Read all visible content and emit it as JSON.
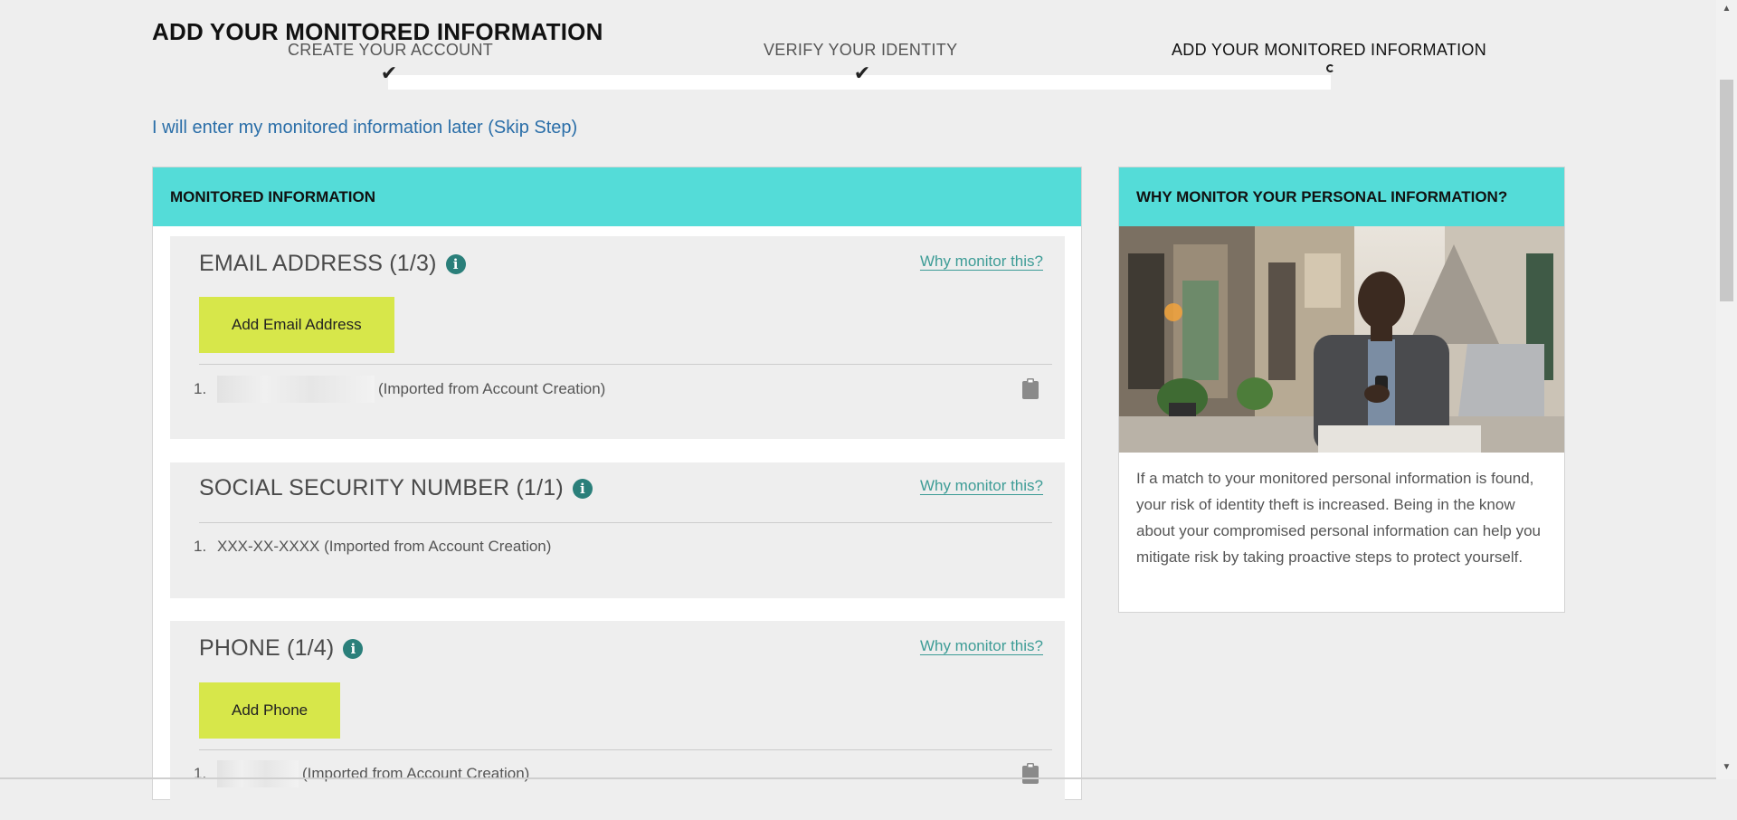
{
  "page": {
    "title": "ADD YOUR MONITORED INFORMATION"
  },
  "stepper": {
    "steps": [
      {
        "label": "CREATE YOUR ACCOUNT",
        "status": "complete"
      },
      {
        "label": "VERIFY YOUR IDENTITY",
        "status": "complete"
      },
      {
        "label": "ADD YOUR MONITORED INFORMATION",
        "status": "current"
      }
    ]
  },
  "skip_link": "I will enter my monitored information later (Skip Step)",
  "main_panel": {
    "header": "MONITORED INFORMATION",
    "sections": [
      {
        "title": "EMAIL ADDRESS (1/3)",
        "why_link": "Why monitor this?",
        "button": "Add Email Address",
        "items": [
          {
            "num": "1.",
            "text": "(Imported from Account Creation)"
          }
        ]
      },
      {
        "title": "SOCIAL SECURITY NUMBER (1/1)",
        "why_link": "Why monitor this?",
        "items": [
          {
            "num": "1.",
            "text": "XXX-XX-XXXX (Imported from Account Creation)"
          }
        ]
      },
      {
        "title": "PHONE (1/4)",
        "why_link": "Why monitor this?",
        "button": "Add Phone",
        "items": [
          {
            "num": "1.",
            "text": "(Imported from Account Creation)"
          }
        ]
      }
    ]
  },
  "side_panel": {
    "header": "WHY MONITOR YOUR PERSONAL INFORMATION?",
    "body": "If a match to your monitored personal information is found, your risk of identity theft is increased. Being in the know about your compromised personal information can help you mitigate risk by taking proactive steps to protect yourself."
  },
  "icons": {
    "info": "info-icon",
    "delete": "clipboard-icon",
    "check": "check-icon"
  },
  "colors": {
    "header_bg": "#54dcd8",
    "button_bg": "#d7e74a",
    "link": "#2a6ea8",
    "why_link": "#3d9c96",
    "info_icon": "#2a7f7a"
  }
}
